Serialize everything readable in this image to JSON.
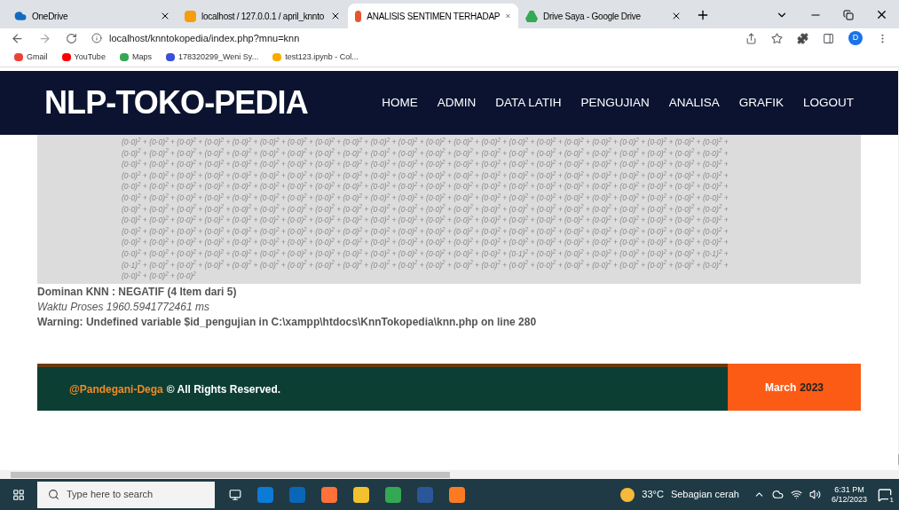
{
  "browser": {
    "tabs": [
      {
        "title": "OneDrive",
        "selected": false
      },
      {
        "title": "localhost / 127.0.0.1 / april_knnto",
        "selected": false
      },
      {
        "title": "ANALISIS SENTIMEN TERHADAP",
        "selected": true
      },
      {
        "title": "Drive Saya - Google Drive",
        "selected": false
      }
    ],
    "address": "localhost/knntokopedia/index.php?mnu=knn",
    "profile": "D",
    "bookmarks": [
      "Gmail",
      "YouTube",
      "Maps",
      "178320299_Weni Sy...",
      "test123.ipynb - Col..."
    ]
  },
  "site": {
    "logo": "NLP-TOKO-PEDIA",
    "nav": [
      "HOME",
      "ADMIN",
      "DATA LATIH",
      "PENGUJIAN",
      "ANALISA",
      "GRAFIK",
      "LOGOUT"
    ]
  },
  "result": {
    "formula_lines": [
      "(0-0)$^{2}$ + (0-0)$^{2}$ + (0-0)$^{2}$ + (0-0)$^{2}$ + (0-0)$^{2}$ + (0-0)$^{2}$ + (0-0)$^{2}$ + (0-0)$^{2}$ + (0-0)$^{2}$ + (0-0)$^{2}$ + (0-0)$^{2}$ + (0-0)$^{2}$ + (0-0)$^{2}$ + (0-0)$^{2}$ + (0-0)$^{2}$ + (0-0)$^{2}$ + (0-0)$^{2}$ + (0-0)$^{2}$ + (0-0)$^{2}$ + (0-0)$^{2}$ + (0-0)$^{2}$ + (0-0)$^{2}$ +",
      "(0-0)$^{2}$ + (0-0)$^{2}$ + (0-0)$^{2}$ + (0-0)$^{2}$ + (0-0)$^{2}$ + (0-0)$^{2}$ + (0-0)$^{2}$ + (0-0)$^{2}$ + (0-0)$^{2}$ + (0-0)$^{2}$ + (0-0)$^{2}$ + (0-0)$^{2}$ + (0-0)$^{2}$ + (0-0)$^{2}$ + (0-0)$^{2}$ + (0-0)$^{2}$ + (0-0)$^{2}$ + (0-0)$^{2}$ + (0-0)$^{2}$ + (0-0)$^{2}$ + (0-0)$^{2}$ + (0-0)$^{2}$ +",
      "(0-0)$^{2}$ + (0-0)$^{2}$ + (0-0)$^{2}$ + (0-0)$^{2}$ + (0-0)$^{2}$ + (0-0)$^{2}$ + (0-0)$^{2}$ + (0-0)$^{2}$ + (0-0)$^{2}$ + (0-0)$^{2}$ + (0-0)$^{2}$ + (0-0)$^{2}$ + (0-0)$^{2}$ + (0-0)$^{2}$ + (0-0)$^{2}$ + (0-0)$^{2}$ + (0-0)$^{2}$ + (0-0)$^{2}$ + (0-0)$^{2}$ + (0-0)$^{2}$ + (0-0)$^{2}$ + (0-0)$^{2}$ +",
      "(0-0)$^{2}$ + (0-0)$^{2}$ + (0-0)$^{2}$ + (0-0)$^{2}$ + (0-0)$^{2}$ + (0-0)$^{2}$ + (0-0)$^{2}$ + (0-0)$^{2}$ + (0-0)$^{2}$ + (0-0)$^{2}$ + (0-0)$^{2}$ + (0-0)$^{2}$ + (0-0)$^{2}$ + (0-0)$^{2}$ + (0-0)$^{2}$ + (0-0)$^{2}$ + (0-0)$^{2}$ + (0-0)$^{2}$ + (0-0)$^{2}$ + (0-0)$^{2}$ + (0-0)$^{2}$ + (0-0)$^{2}$ +",
      "(0-0)$^{2}$ + (0-0)$^{2}$ + (0-0)$^{2}$ + (0-0)$^{2}$ + (0-0)$^{2}$ + (0-0)$^{2}$ + (0-0)$^{2}$ + (0-0)$^{2}$ + (0-0)$^{2}$ + (0-0)$^{2}$ + (0-0)$^{2}$ + (0-0)$^{2}$ + (0-0)$^{2}$ + (0-0)$^{2}$ + (0-0)$^{2}$ + (0-0)$^{2}$ + (0-0)$^{2}$ + (0-0)$^{2}$ + (0-0)$^{2}$ + (0-0)$^{2}$ + (0-0)$^{2}$ + (0-0)$^{2}$ +",
      "(0-0)$^{2}$ + (0-0)$^{2}$ + (0-0)$^{2}$ + (0-0)$^{2}$ + (0-0)$^{2}$ + (0-0)$^{2}$ + (0-0)$^{2}$ + (0-0)$^{2}$ + (0-0)$^{2}$ + (0-0)$^{2}$ + (0-0)$^{2}$ + (0-0)$^{2}$ + (0-0)$^{2}$ + (0-0)$^{2}$ + (0-0)$^{2}$ + (0-0)$^{2}$ + (0-0)$^{2}$ + (0-0)$^{2}$ + (0-0)$^{2}$ + (0-0)$^{2}$ + (0-0)$^{2}$ + (0-0)$^{2}$ +",
      "(0-0)$^{2}$ + (0-0)$^{2}$ + (0-0)$^{2}$ + (0-0)$^{2}$ + (0-0)$^{2}$ + (0-0)$^{2}$ + (0-0)$^{2}$ + (0-0)$^{2}$ + (0-0)$^{2}$ + (0-0)$^{2}$ + (0-0)$^{2}$ + (0-0)$^{2}$ + (0-0)$^{2}$ + (0-0)$^{2}$ + (0-0)$^{2}$ + (0-0)$^{2}$ + (0-0)$^{2}$ + (0-0)$^{2}$ + (0-0)$^{2}$ + (0-0)$^{2}$ + (0-0)$^{2}$ + (0-0)$^{2}$ +",
      "(0-0)$^{2}$ + (0-0)$^{2}$ + (0-0)$^{2}$ + (0-0)$^{2}$ + (0-0)$^{2}$ + (0-0)$^{2}$ + (0-0)$^{2}$ + (0-0)$^{2}$ + (0-0)$^{2}$ + (0-0)$^{2}$ + (0-0)$^{2}$ + (0-0)$^{2}$ + (0-0)$^{2}$ + (0-0)$^{2}$ + (0-0)$^{2}$ + (0-0)$^{2}$ + (0-0)$^{2}$ + (0-0)$^{2}$ + (0-0)$^{2}$ + (0-0)$^{2}$ + (0-0)$^{2}$ + (0-0)$^{2}$ +",
      "(0-0)$^{2}$ + (0-0)$^{2}$ + (0-0)$^{2}$ + (0-0)$^{2}$ + (0-0)$^{2}$ + (0-0)$^{2}$ + (0-0)$^{2}$ + (0-0)$^{2}$ + (0-0)$^{2}$ + (0-0)$^{2}$ + (0-0)$^{2}$ + (0-0)$^{2}$ + (0-0)$^{2}$ + (0-0)$^{2}$ + (0-0)$^{2}$ + (0-0)$^{2}$ + (0-0)$^{2}$ + (0-0)$^{2}$ + (0-0)$^{2}$ + (0-0)$^{2}$ + (0-0)$^{2}$ + (0-0)$^{2}$ +",
      "(0-0)$^{2}$ + (0-0)$^{2}$ + (0-0)$^{2}$ + (0-0)$^{2}$ + (0-0)$^{2}$ + (0-0)$^{2}$ + (0-0)$^{2}$ + (0-0)$^{2}$ + (0-0)$^{2}$ + (0-0)$^{2}$ + (0-0)$^{2}$ + (0-0)$^{2}$ + (0-0)$^{2}$ + (0-0)$^{2}$ + (0-0)$^{2}$ + (0-0)$^{2}$ + (0-0)$^{2}$ + (0-0)$^{2}$ + (0-0)$^{2}$ + (0-0)$^{2}$ + (0-0)$^{2}$ + (0-0)$^{2}$ +",
      "(0-0)$^{2}$ + (0-0)$^{2}$ + (0-0)$^{2}$ + (0-0)$^{2}$ + (0-0)$^{2}$ + (0-0)$^{2}$ + (0-0)$^{2}$ + (0-0)$^{2}$ + (0-0)$^{2}$ + (0-0)$^{2}$ + (0-0)$^{2}$ + (0-0)$^{2}$ + (0-0)$^{2}$ + (0-0)$^{2}$ + (0-1)$^{2}$ + (0-0)$^{2}$ + (0-0)$^{2}$ + (0-0)$^{2}$ + (0-0)$^{2}$ + (0-0)$^{2}$ + (0-0)$^{2}$ + (0-1)$^{2}$ +",
      "(0-1)$^{2}$ + (0-0)$^{2}$ + (0-0)$^{2}$ + (0-0)$^{2}$ + (0-0)$^{2}$ + (0-0)$^{2}$ + (0-0)$^{2}$ + (0-0)$^{2}$ + (0-0)$^{2}$ + (0-0)$^{2}$ + (0-0)$^{2}$ + (0-0)$^{2}$ + (0-0)$^{2}$ + (0-0)$^{2}$ + (0-0)$^{2}$ + (0-0)$^{2}$ + (0-0)$^{2}$ + (0-0)$^{2}$ + (0-0)$^{2}$ + (0-0)$^{2}$ + (0-0)$^{2}$ + (0-0)$^{2}$ +",
      "(0-0)$^{2}$ + (0-0)$^{2}$ + (0-0)$^{2}$"
    ],
    "dominant": "Dominan KNN : NEGATIF (4 Item dari 5)",
    "process_time": "Waktu Proses 1960.5941772461 ms",
    "warning": "Warning: Undefined variable $id_pengujian in C:\\xampp\\htdocs\\KnnTokopedia\\knn.php on line 280"
  },
  "footer": {
    "owner": "@Pandegani-Dega",
    "rights": "© All Rights Reserved.",
    "month": "March",
    "year": "2023"
  },
  "taskbar": {
    "search_placeholder": "Type here to search",
    "temperature": "33°C",
    "weather": "Sebagian cerah",
    "time": "6:31 PM",
    "date": "6/12/2023",
    "notification_count": "1"
  }
}
